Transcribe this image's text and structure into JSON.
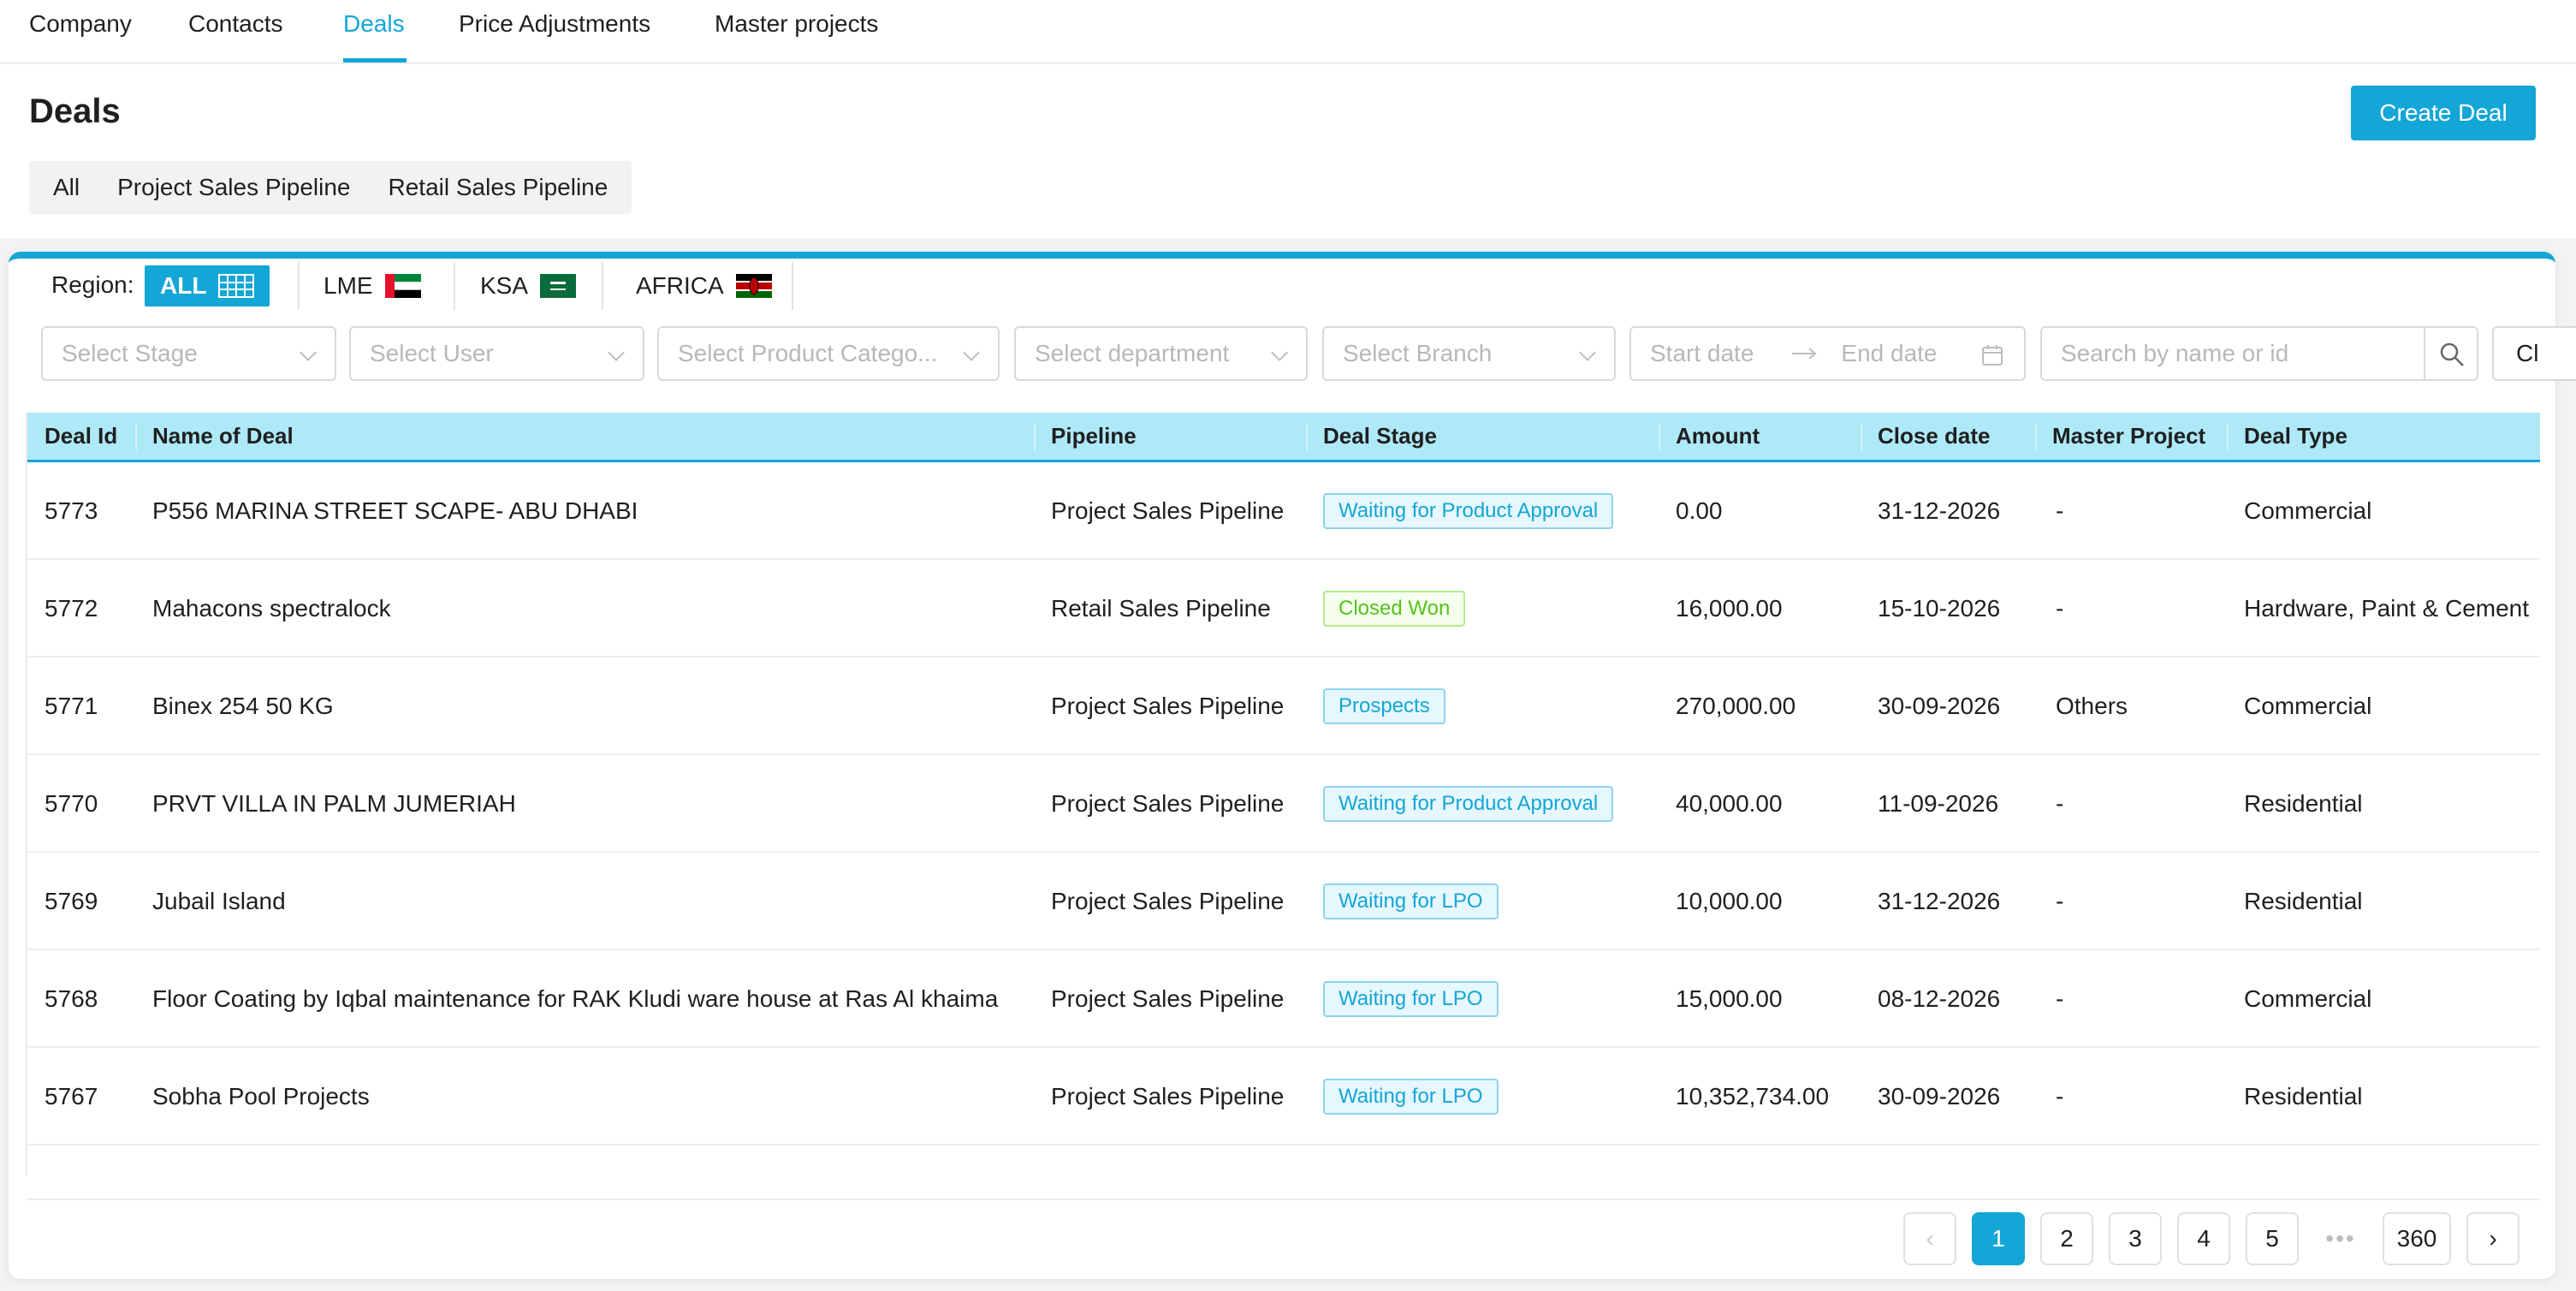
{
  "nav": {
    "tabs": [
      "Company",
      "Contacts",
      "Deals",
      "Price Adjustments",
      "Master projects"
    ],
    "active_tab": "Deals"
  },
  "header": {
    "title": "Deals",
    "create_button": "Create Deal"
  },
  "pipelines": [
    "All",
    "Project Sales Pipeline",
    "Retail Sales Pipeline"
  ],
  "region": {
    "label": "Region:",
    "options": [
      "ALL",
      "LME",
      "KSA",
      "AFRICA"
    ],
    "selected": "ALL"
  },
  "filters": {
    "stage_placeholder": "Select Stage",
    "user_placeholder": "Select User",
    "product_category_placeholder": "Select Product Catego...",
    "department_placeholder": "Select department",
    "branch_placeholder": "Select Branch",
    "start_date_placeholder": "Start date",
    "end_date_placeholder": "End date",
    "search_placeholder": "Search by name or id",
    "clear_label": "Cl"
  },
  "table": {
    "columns": [
      "Deal Id",
      "Name of Deal",
      "Pipeline",
      "Deal Stage",
      "Amount",
      "Close date",
      "Master Project",
      "Deal Type"
    ],
    "rows": [
      {
        "id": "5773",
        "name": "P556 MARINA STREET SCAPE- ABU DHABI",
        "pipeline": "Project Sales Pipeline",
        "stage": "Waiting for Product Approval",
        "stage_color": "blue",
        "amount": "0.00",
        "close_date": "31-12-2026",
        "master_project": "-",
        "deal_type": "Commercial"
      },
      {
        "id": "5772",
        "name": "Mahacons spectralock",
        "pipeline": "Retail Sales Pipeline",
        "stage": "Closed Won",
        "stage_color": "green",
        "amount": "16,000.00",
        "close_date": "15-10-2026",
        "master_project": "-",
        "deal_type": "Hardware, Paint & Cement"
      },
      {
        "id": "5771",
        "name": "Binex 254 50 KG",
        "pipeline": "Project Sales Pipeline",
        "stage": "Prospects",
        "stage_color": "blue",
        "amount": "270,000.00",
        "close_date": "30-09-2026",
        "master_project": "Others",
        "deal_type": "Commercial"
      },
      {
        "id": "5770",
        "name": "PRVT VILLA IN PALM JUMERIAH",
        "pipeline": "Project Sales Pipeline",
        "stage": "Waiting for Product Approval",
        "stage_color": "blue",
        "amount": "40,000.00",
        "close_date": "11-09-2026",
        "master_project": "-",
        "deal_type": "Residential"
      },
      {
        "id": "5769",
        "name": "Jubail Island",
        "pipeline": "Project Sales Pipeline",
        "stage": "Waiting for LPO",
        "stage_color": "blue",
        "amount": "10,000.00",
        "close_date": "31-12-2026",
        "master_project": "-",
        "deal_type": "Residential"
      },
      {
        "id": "5768",
        "name": "Floor Coating by Iqbal maintenance for RAK Kludi ware house at Ras Al khaima",
        "pipeline": "Project Sales Pipeline",
        "stage": "Waiting for LPO",
        "stage_color": "blue",
        "amount": "15,000.00",
        "close_date": "08-12-2026",
        "master_project": "-",
        "deal_type": "Commercial"
      },
      {
        "id": "5767",
        "name": "Sobha Pool Projects",
        "pipeline": "Project Sales Pipeline",
        "stage": "Waiting for LPO",
        "stage_color": "blue",
        "amount": "10,352,734.00",
        "close_date": "30-09-2026",
        "master_project": "-",
        "deal_type": "Residential"
      }
    ]
  },
  "pagination": {
    "pages": [
      "1",
      "2",
      "3",
      "4",
      "5"
    ],
    "current": "1",
    "ellipsis": "•••",
    "last": "360",
    "prev": "‹",
    "next": "›"
  },
  "colors": {
    "accent": "#13a6d6",
    "header_bg": "#aee9f8",
    "success": "#52c41a"
  }
}
